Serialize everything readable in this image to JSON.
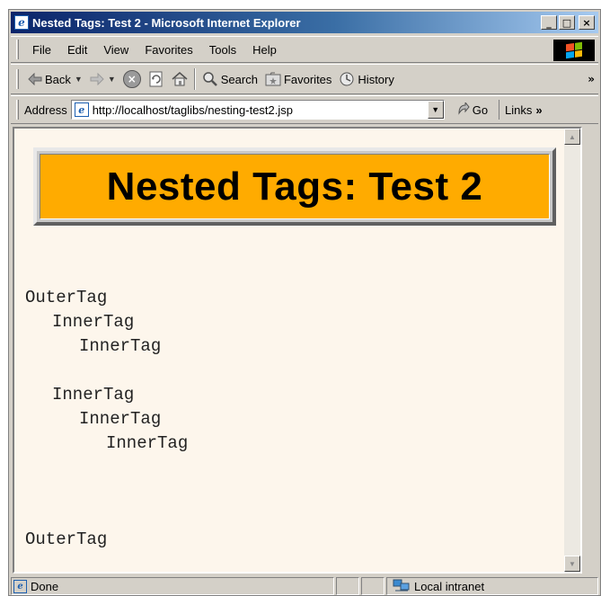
{
  "window": {
    "title": "Nested Tags: Test 2 - Microsoft Internet Explorer",
    "controls": {
      "minimize": "_",
      "maximize": "□",
      "close": "×"
    }
  },
  "menubar": {
    "items": [
      "File",
      "Edit",
      "View",
      "Favorites",
      "Tools",
      "Help"
    ]
  },
  "toolbar": {
    "back_label": "Back",
    "search_label": "Search",
    "favorites_label": "Favorites",
    "history_label": "History",
    "overflow": "»"
  },
  "addressbar": {
    "label": "Address",
    "url": "http://localhost/taglibs/nesting-test2.jsp",
    "go_label": "Go",
    "links_label": "Links",
    "overflow": "»"
  },
  "page": {
    "banner_title": "Nested Tags: Test 2",
    "banner_color": "#ffab00",
    "background_color": "#fdf6ec",
    "tag_lines": [
      "OuterTag",
      "InnerTag",
      "InnerTag",
      "InnerTag",
      "InnerTag",
      "InnerTag",
      "OuterTag"
    ]
  },
  "statusbar": {
    "status": "Done",
    "zone": "Local intranet"
  }
}
